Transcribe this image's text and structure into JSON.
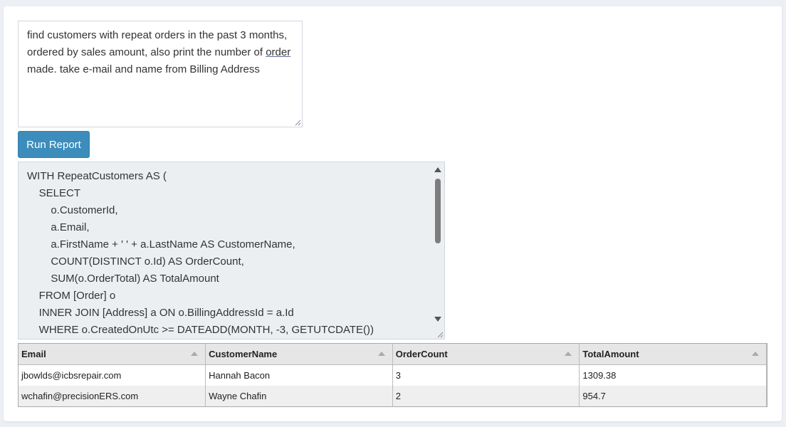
{
  "prompt": {
    "line1": "find customers with repeat orders in the past 3 months,",
    "line2_pre": "ordered by sales amount, also print the number of ",
    "line2_link": "order",
    "line3": "made. take e-mail and name from Billing Address"
  },
  "run_button": {
    "label": "Run Report"
  },
  "sql": {
    "lines": [
      "WITH RepeatCustomers AS (",
      "    SELECT",
      "        o.CustomerId,",
      "        a.Email,",
      "        a.FirstName + ' ' + a.LastName AS CustomerName,",
      "        COUNT(DISTINCT o.Id) AS OrderCount,",
      "        SUM(o.OrderTotal) AS TotalAmount",
      "    FROM [Order] o",
      "    INNER JOIN [Address] a ON o.BillingAddressId = a.Id",
      "    WHERE o.CreatedOnUtc >= DATEADD(MONTH, -3, GETUTCDATE())"
    ]
  },
  "results": {
    "columns": [
      "Email",
      "CustomerName",
      "OrderCount",
      "TotalAmount"
    ],
    "rows": [
      [
        "jbowlds@icbsrepair.com",
        "Hannah Bacon",
        "3",
        "1309.38"
      ],
      [
        "wchafin@precisionERS.com",
        "Wayne Chafin",
        "2",
        "954.7"
      ]
    ]
  }
}
